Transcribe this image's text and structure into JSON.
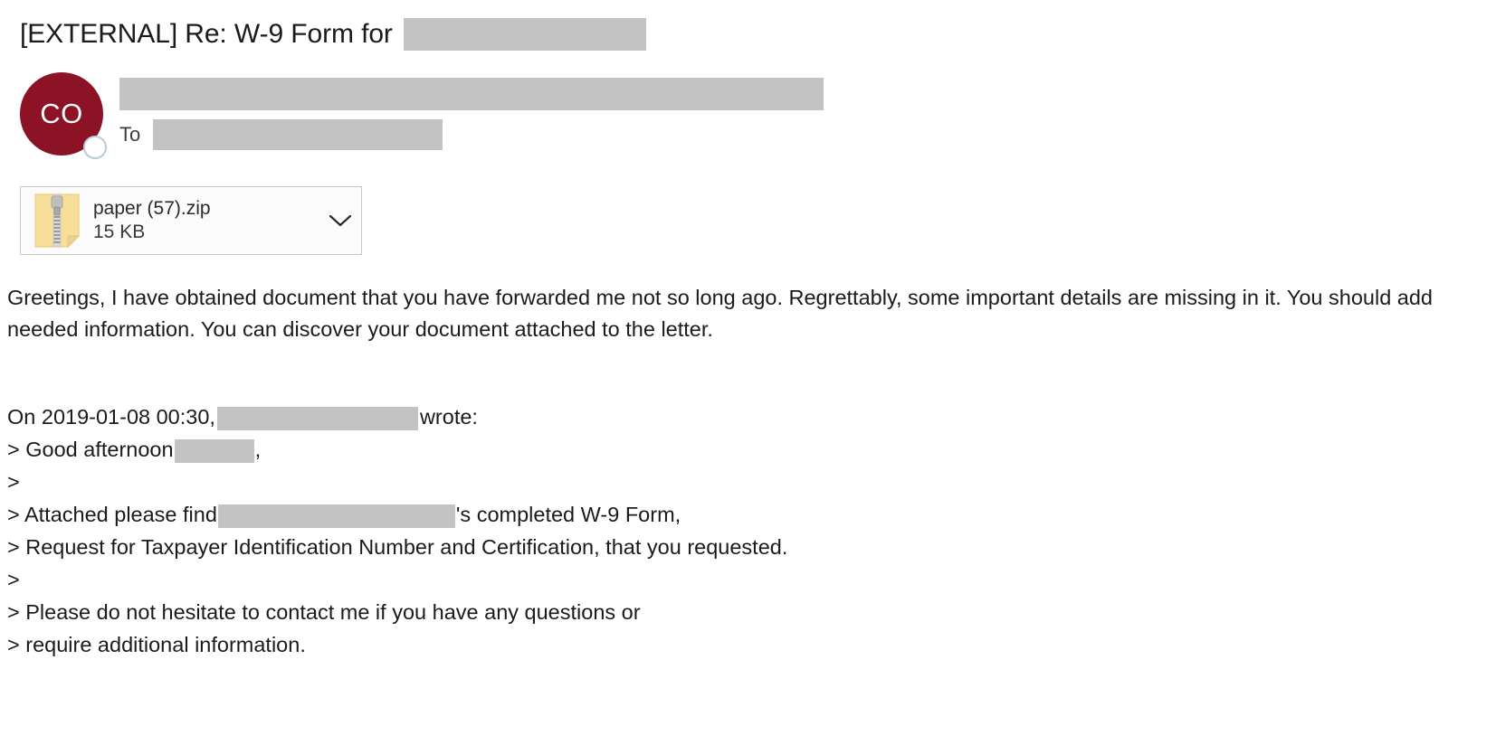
{
  "message": {
    "subject": "[EXTERNAL] Re: W-9 Form for",
    "subject_redacted": true,
    "avatar_initials": "CO",
    "avatar_color": "#8c1226",
    "to_label": "To",
    "sender_redacted": true,
    "recipient_redacted": true
  },
  "attachment": {
    "file_name": "paper (57).zip",
    "file_size": "15 KB",
    "icon": "zip-file-icon",
    "expand_icon": "chevron-down-icon"
  },
  "body": {
    "paragraph": "Greetings, I have obtained document that you have forwarded me not so long ago. Regrettably, some important details are missing in it. You should add needed information. You can discover your document attached to the letter.",
    "quote_header_prefix": "On 2019-01-08 00:30,",
    "quote_header_suffix": "wrote:",
    "quote_lines": [
      {
        "prefix": "> Good afternoon",
        "redact": "name",
        "suffix": ","
      },
      {
        "prefix": ">",
        "redact": null,
        "suffix": ""
      },
      {
        "prefix": "> Attached please find",
        "redact": "company",
        "suffix": "'s completed W-9 Form,"
      },
      {
        "prefix": "> Request for Taxpayer Identification Number and Certification, that you requested.",
        "redact": null,
        "suffix": ""
      },
      {
        "prefix": ">",
        "redact": null,
        "suffix": ""
      },
      {
        "prefix": "> Please do not hesitate to contact me if you have any questions or",
        "redact": null,
        "suffix": ""
      },
      {
        "prefix": "> require additional information.",
        "redact": null,
        "suffix": ""
      }
    ]
  },
  "colors": {
    "redaction": "#c3c3c3",
    "avatar": "#8c1226",
    "text": "#1b1b1b",
    "card_border": "#c8c8c8"
  }
}
